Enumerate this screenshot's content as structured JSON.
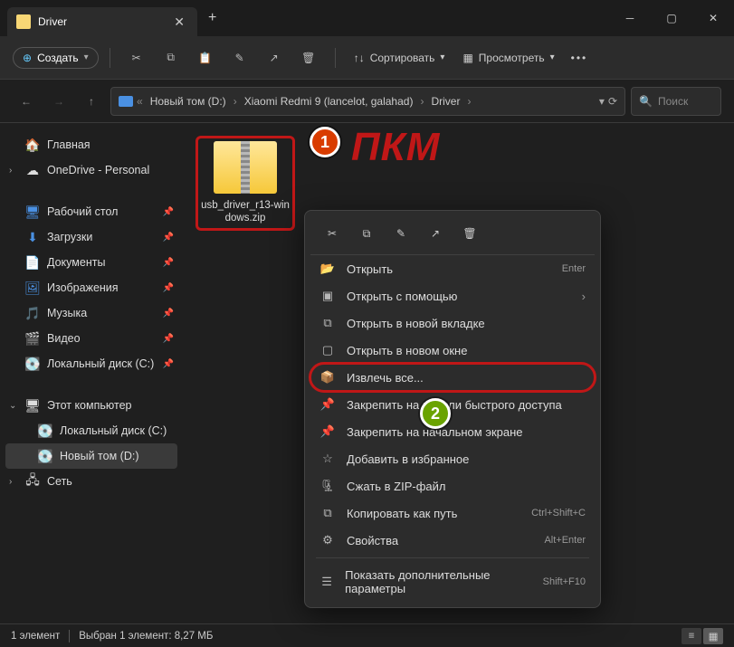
{
  "window": {
    "title": "Driver"
  },
  "toolbar": {
    "create": "Создать",
    "sort": "Сортировать",
    "view": "Просмотреть"
  },
  "breadcrumbs": [
    "Новый том (D:)",
    "Xiaomi Redmi 9 (lancelot, galahad)",
    "Driver"
  ],
  "search": {
    "placeholder": "Поиск"
  },
  "sidebar": {
    "home": "Главная",
    "onedrive": "OneDrive - Personal",
    "quick": [
      "Рабочий стол",
      "Загрузки",
      "Документы",
      "Изображения",
      "Музыка",
      "Видео",
      "Локальный диск (C:)"
    ],
    "thispc_label": "Этот компьютер",
    "thispc": [
      "Локальный диск (C:)",
      "Новый том (D:)"
    ],
    "network": "Сеть"
  },
  "file": {
    "name": "usb_driver_r13-windows.zip"
  },
  "ctx": {
    "open": "Открыть",
    "open_shortcut": "Enter",
    "openwith": "Открыть с помощью",
    "newtab": "Открыть в новой вкладке",
    "newwin": "Открыть в новом окне",
    "extract": "Извлечь все...",
    "pinquick": "Закрепить на панели быстрого доступа",
    "pinstart": "Закрепить на начальном экране",
    "addfav": "Добавить в избранное",
    "zip": "Сжать в ZIP-файл",
    "copypath": "Копировать как путь",
    "copypath_shortcut": "Ctrl+Shift+C",
    "props": "Свойства",
    "props_shortcut": "Alt+Enter",
    "more": "Показать дополнительные параметры",
    "more_shortcut": "Shift+F10"
  },
  "status": {
    "count": "1 элемент",
    "selection": "Выбран 1 элемент: 8,27 МБ"
  },
  "annotation": {
    "badge1": "1",
    "badge2": "2",
    "label": "ПКМ"
  }
}
